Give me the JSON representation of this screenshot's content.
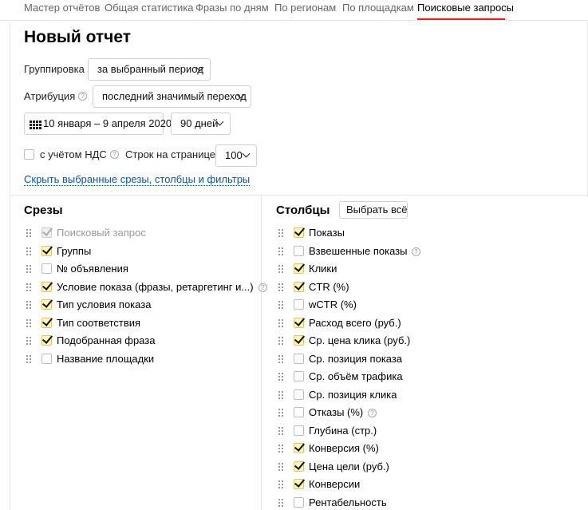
{
  "tabs": [
    {
      "label": "Мастер отчётов"
    },
    {
      "label": "Общая статистика"
    },
    {
      "label": "Фразы по дням"
    },
    {
      "label": "По регионам"
    },
    {
      "label": "По площадкам"
    },
    {
      "label": "Поисковые запросы",
      "active": true
    }
  ],
  "title": "Новый отчет",
  "grouping": {
    "label": "Группировка",
    "value": "за выбранный период"
  },
  "attribution": {
    "label": "Атрибуция",
    "value": "последний значимый переход"
  },
  "date_range": {
    "value": "10 января – 9 апреля 2020",
    "period": "90 дней"
  },
  "vat": {
    "label": "с учётом НДС"
  },
  "rows_per_page": {
    "label": "Строк на странице",
    "value": "100"
  },
  "hide_link": "Скрыть выбранные срезы, столбцы и фильтры",
  "slices": {
    "title": "Срезы",
    "items": [
      {
        "label": "Поисковый запрос",
        "checked": true,
        "disabled": true
      },
      {
        "label": "Группы",
        "checked": true
      },
      {
        "label": "№ объявления",
        "checked": false
      },
      {
        "label": "Условие показа (фразы, ретаргетинг и...)",
        "checked": true,
        "help": true
      },
      {
        "label": "Тип условия показа",
        "checked": true
      },
      {
        "label": "Тип соответствия",
        "checked": true
      },
      {
        "label": "Подобранная фраза",
        "checked": true
      },
      {
        "label": "Название площадки",
        "checked": false
      }
    ]
  },
  "columns": {
    "title": "Столбцы",
    "select_all": "Выбрать всё",
    "items": [
      {
        "label": "Показы",
        "checked": true
      },
      {
        "label": "Взвешенные показы",
        "checked": false,
        "help": true
      },
      {
        "label": "Клики",
        "checked": true
      },
      {
        "label": "CTR (%)",
        "checked": true
      },
      {
        "label": "wCTR (%)",
        "checked": false
      },
      {
        "label": "Расход всего (руб.)",
        "checked": true
      },
      {
        "label": "Ср. цена клика (руб.)",
        "checked": true
      },
      {
        "label": "Ср. позиция показа",
        "checked": false
      },
      {
        "label": "Ср. объём трафика",
        "checked": false
      },
      {
        "label": "Ср. позиция клика",
        "checked": false
      },
      {
        "label": "Отказы (%)",
        "checked": false,
        "help": true
      },
      {
        "label": "Глубина (стр.)",
        "checked": false
      },
      {
        "label": "Конверсия (%)",
        "checked": true
      },
      {
        "label": "Цена цели (руб.)",
        "checked": true
      },
      {
        "label": "Конверсии",
        "checked": true
      },
      {
        "label": "Рентабельность",
        "checked": false
      }
    ]
  },
  "help_glyph": "?"
}
